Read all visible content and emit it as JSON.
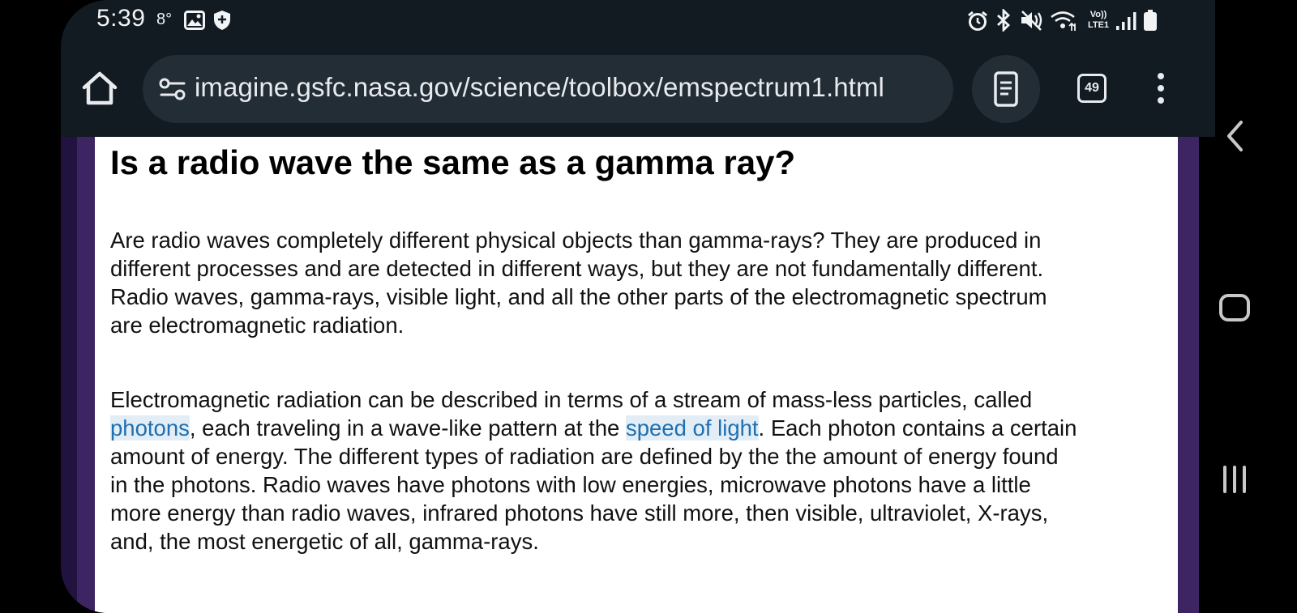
{
  "status_bar": {
    "time": "5:39",
    "temperature": "8°",
    "icons": [
      "gallery-icon",
      "shield-icon",
      "alarm-icon",
      "bluetooth-icon",
      "mute-icon",
      "wifi-icon",
      "volte-icon",
      "signal-icon",
      "battery-icon"
    ],
    "volte_text": "Vo)) LTE1"
  },
  "toolbar": {
    "url": "imagine.gsfc.nasa.gov/science/toolbox/emspectrum1.html",
    "tab_count": "49"
  },
  "article": {
    "heading": "Is a radio wave the same as a gamma ray?",
    "para1_lines": [
      "Are radio waves completely different physical objects than gamma-rays? They are produced in",
      "different processes and are detected in different ways, but they are not fundamentally different.",
      "Radio waves, gamma-rays, visible light, and all the other parts of the electromagnetic spectrum",
      "are electromagnetic radiation."
    ],
    "para2": {
      "line1": "Electromagnetic radiation can be described in terms of a stream of mass-less particles, called",
      "link_photons": "photons",
      "line2_mid": ", each traveling in a wave-like pattern at the ",
      "link_speed": "speed of light",
      "line2_end": ". Each photon contains a certain",
      "line3": "amount of energy. The different types of radiation are defined by the the amount of energy found",
      "line4": "in the photons. Radio waves have photons with low energies, microwave photons have a little",
      "line5": "more energy than radio waves, infrared photons have still more, then visible, ultraviolet, X-rays,",
      "line6": "and, the most energetic of all, gamma-rays."
    }
  },
  "colors": {
    "link": "#1f6fb0",
    "frame_purple": "#3c2562",
    "toolbar_bg": "#121a22"
  },
  "navbar": {
    "icons": [
      "back-icon",
      "home-circle-icon",
      "recents-icon"
    ]
  }
}
